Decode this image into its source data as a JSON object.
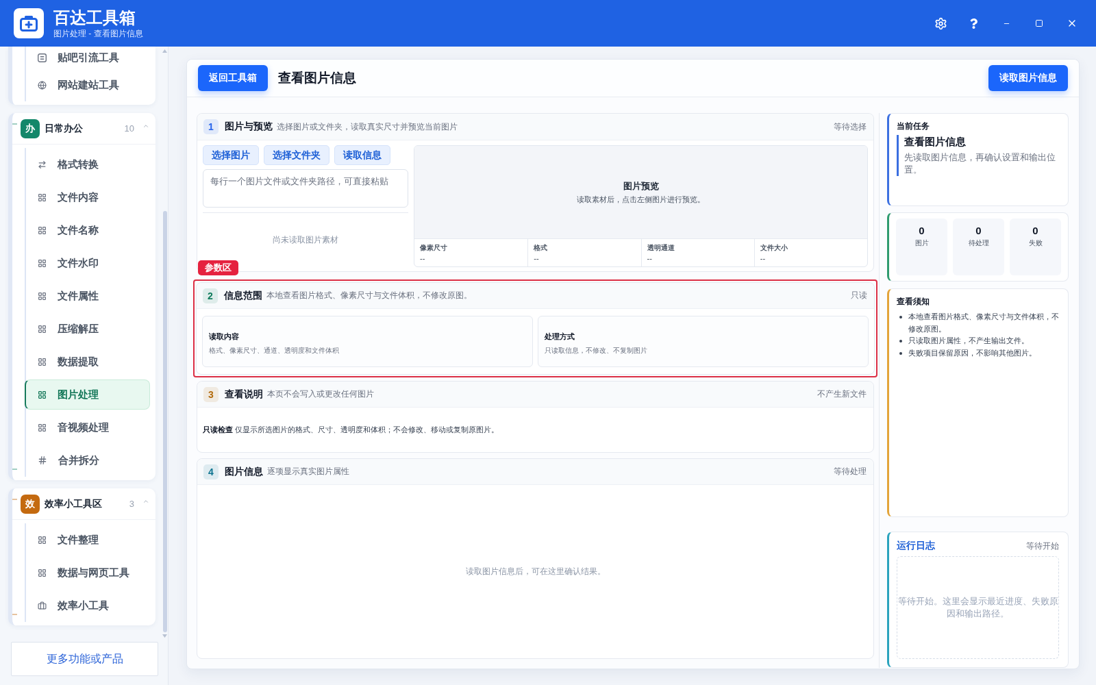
{
  "window": {
    "title": "百达工具箱",
    "subtitle": "图片处理 - 查看图片信息",
    "controls": [
      {
        "kind": "settings"
      },
      {
        "kind": "help"
      },
      {
        "kind": "minimize"
      },
      {
        "kind": "maximize"
      },
      {
        "kind": "close"
      }
    ]
  },
  "sidebar": {
    "groups": [
      {
        "items": [
          {
            "label": "贴吧引流工具",
            "kind": "note",
            "selected": false
          },
          {
            "label": "网站建站工具",
            "kind": "globe",
            "selected": false
          }
        ]
      },
      {
        "badge": "办",
        "color": "#13876a",
        "title": "日常办公",
        "count": "10",
        "expanded": true,
        "items": [
          {
            "label": "格式转换",
            "kind": "swap",
            "selected": false
          },
          {
            "label": "文件内容",
            "kind": "grid",
            "selected": false
          },
          {
            "label": "文件名称",
            "kind": "grid",
            "selected": false
          },
          {
            "label": "文件水印",
            "kind": "grid",
            "selected": false
          },
          {
            "label": "文件属性",
            "kind": "grid",
            "selected": false
          },
          {
            "label": "压缩解压",
            "kind": "grid",
            "selected": false
          },
          {
            "label": "数据提取",
            "kind": "grid",
            "selected": false
          },
          {
            "label": "图片处理",
            "kind": "grid",
            "selected": true
          },
          {
            "label": "音视频处理",
            "kind": "grid",
            "selected": false
          },
          {
            "label": "合并拆分",
            "kind": "hash",
            "selected": false
          }
        ]
      },
      {
        "badge": "效",
        "color": "#c46a10",
        "title": "效率小工具区",
        "count": "3",
        "expanded": true,
        "items": [
          {
            "label": "文件整理",
            "kind": "grid",
            "selected": false
          },
          {
            "label": "数据与网页工具",
            "kind": "grid",
            "selected": false
          },
          {
            "label": "效率小工具",
            "kind": "case",
            "selected": false
          }
        ]
      }
    ],
    "more_button": "更多功能或产品"
  },
  "header": {
    "back_button": "返回工具箱",
    "title": "查看图片信息",
    "action_button": "读取图片信息"
  },
  "sections": [
    {
      "kind": "source",
      "number": "1",
      "color": "#2563eb",
      "title": "图片与预览",
      "description": "选择图片或文件夹，读取真实尺寸并预览当前图片",
      "status": "等待选择",
      "highlighted": false,
      "buttons": [
        "选择图片",
        "选择文件夹",
        "读取信息"
      ],
      "path_field": {
        "placeholder": "每行一个图片文件或文件夹路径，可直接粘贴"
      },
      "empty_text": "尚未读取图片素材",
      "preview": {
        "title": "图片预览",
        "hint": "读取素材后，点击左侧图片进行预览。",
        "meta": [
          {
            "label": "像素尺寸",
            "value": "--"
          },
          {
            "label": "格式",
            "value": "--"
          },
          {
            "label": "透明通道",
            "value": "--"
          },
          {
            "label": "文件大小",
            "value": "--"
          }
        ]
      }
    },
    {
      "kind": "scope",
      "number": "2",
      "color": "#0f7b5c",
      "title": "信息范围",
      "description": "本地查看图片格式、像素尺寸与文件体积，不修改原图。",
      "status": "只读",
      "highlighted": true,
      "highlight_label": "参数区",
      "cards": [
        {
          "title": "读取内容",
          "text": "格式、像素尺寸、通道、透明度和文件体积"
        },
        {
          "title": "处理方式",
          "text": "只读取信息，不修改、不复制图片"
        }
      ]
    },
    {
      "kind": "note",
      "number": "3",
      "color": "#b26a0c",
      "title": "查看说明",
      "description": "本页不会写入或更改任何图片",
      "status": "不产生新文件",
      "highlighted": false,
      "text": "**只读检查** 仅显示所选图片的格式、尺寸、透明度和体积；不会修改、移动或复制原图片。"
    },
    {
      "kind": "results",
      "number": "4",
      "color": "#0e7490",
      "title": "图片信息",
      "description": "逐项显示真实图片属性",
      "status": "等待处理",
      "highlighted": false,
      "empty_text": "读取图片信息后，可在这里确认结果。"
    }
  ],
  "task": {
    "label": "当前任务",
    "title": "查看图片信息",
    "text": "先读取图片信息，再确认设置和输出位置。"
  },
  "stats": [
    {
      "value": "0",
      "label": "图片"
    },
    {
      "value": "0",
      "label": "待处理"
    },
    {
      "value": "0",
      "label": "失败"
    }
  ],
  "notice": {
    "title": "查看须知",
    "items": [
      "本地查看图片格式、像素尺寸与文件体积，不修改原图。",
      "只读取图片属性，不产生输出文件。",
      "失败项目保留原因，不影响其他图片。"
    ]
  },
  "log": {
    "title": "运行日志",
    "status": "等待开始",
    "text": "等待开始。这里会显示最近进度、失败原因和输出路径。"
  }
}
